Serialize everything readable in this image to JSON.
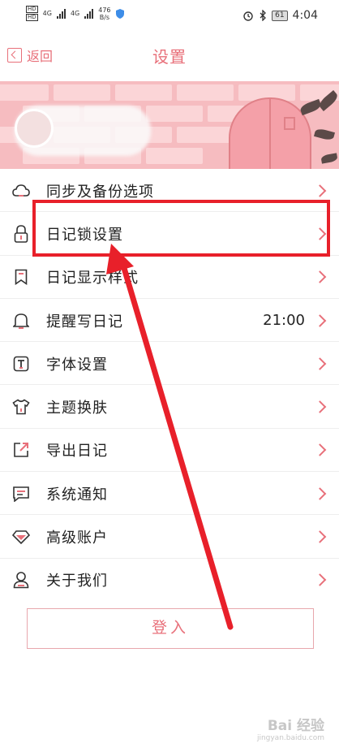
{
  "status_bar": {
    "hd_top": "HD",
    "hd_bottom": "HD",
    "net_a": "4G",
    "net_b": "4G",
    "speed_value": "476",
    "speed_unit": "B/s",
    "battery": "61",
    "time": "4:04"
  },
  "header": {
    "back_label": "返回",
    "title": "设置"
  },
  "menu": {
    "items": [
      {
        "label": "同步及备份选项",
        "icon": "cloud-icon"
      },
      {
        "label": "日记锁设置",
        "icon": "lock-icon"
      },
      {
        "label": "日记显示样式",
        "icon": "bookmark-icon"
      },
      {
        "label": "提醒写日记",
        "icon": "bell-icon",
        "value": "21:00"
      },
      {
        "label": "字体设置",
        "icon": "font-icon"
      },
      {
        "label": "主题换肤",
        "icon": "shirt-icon"
      },
      {
        "label": "导出日记",
        "icon": "export-icon"
      },
      {
        "label": "系统通知",
        "icon": "message-icon"
      },
      {
        "label": "高级账户",
        "icon": "diamond-icon"
      },
      {
        "label": "关于我们",
        "icon": "user-icon"
      }
    ]
  },
  "login_label": "登入",
  "colors": {
    "accent": "#e8707a",
    "highlight": "#e8202a"
  },
  "watermark": {
    "brand": "Bai 经验",
    "url": "jingyan.baidu.com"
  }
}
